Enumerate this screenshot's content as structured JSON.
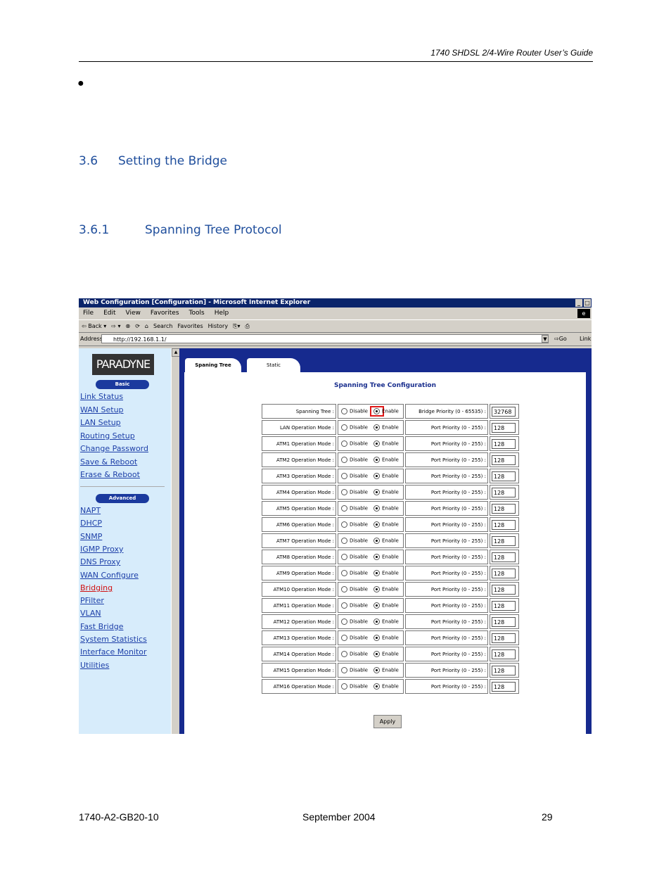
{
  "header": {
    "title": "1740 SHDSL 2/4-Wire Router User’s Guide"
  },
  "bullet": "●",
  "section": {
    "number": "3.6",
    "title": "Setting the Bridge"
  },
  "subsection": {
    "number": "3.6.1",
    "title": "Spanning Tree Protocol"
  },
  "screenshot": {
    "window_title": "Web Configuration [Configuration] - Microsoft Internet Explorer",
    "window_buttons": [
      "_",
      "□"
    ],
    "menu": [
      "File",
      "Edit",
      "View",
      "Favorites",
      "Tools",
      "Help"
    ],
    "toolbar": [
      "⇦ Back ▾",
      "⇨ ▾",
      "⊗",
      "⟳",
      "⌂",
      "Search",
      "Favorites",
      "History",
      "⎘▾",
      "⎙"
    ],
    "address_label": "Address",
    "address_value": "http://192.168.1.1/",
    "go_label": "⇨Go",
    "links_label": "Link",
    "logo": "PARADYNE",
    "basic_label": "Basic",
    "advanced_label": "Advanced",
    "nav_basic": [
      "Link Status",
      "WAN Setup",
      "LAN Setup",
      "Routing Setup",
      "Change Password",
      "Save & Reboot",
      "Erase & Reboot"
    ],
    "nav_advanced": [
      "NAPT",
      "DHCP",
      "SNMP",
      "IGMP Proxy",
      "DNS Proxy",
      "WAN Configure",
      "Bridging",
      "PFilter",
      "VLAN",
      "Fast Bridge",
      "System Statistics",
      "Interface Monitor",
      "Utilities"
    ],
    "tabs": [
      "Spaning Tree",
      "Static"
    ],
    "config_title": "Spanning Tree Configuration",
    "disable_label": "Disable",
    "enable_label": "Enable",
    "rows": [
      {
        "label": "Spanning Tree :",
        "priority_label": "Bridge Priority (0 - 65535) :",
        "value": "32768"
      },
      {
        "label": "LAN Operation Mode :",
        "priority_label": "Port Priority (0 - 255) :",
        "value": "128"
      },
      {
        "label": "ATM1 Operation Mode :",
        "priority_label": "Port Priority (0 - 255) :",
        "value": "128"
      },
      {
        "label": "ATM2 Operation Mode :",
        "priority_label": "Port Priority (0 - 255) :",
        "value": "128"
      },
      {
        "label": "ATM3 Operation Mode :",
        "priority_label": "Port Priority (0 - 255) :",
        "value": "128"
      },
      {
        "label": "ATM4 Operation Mode :",
        "priority_label": "Port Priority (0 - 255) :",
        "value": "128"
      },
      {
        "label": "ATM5 Operation Mode :",
        "priority_label": "Port Priority (0 - 255) :",
        "value": "128"
      },
      {
        "label": "ATM6 Operation Mode :",
        "priority_label": "Port Priority (0 - 255) :",
        "value": "128"
      },
      {
        "label": "ATM7 Operation Mode :",
        "priority_label": "Port Priority (0 - 255) :",
        "value": "128"
      },
      {
        "label": "ATM8 Operation Mode :",
        "priority_label": "Port Priority (0 - 255) :",
        "value": "128"
      },
      {
        "label": "ATM9 Operation Mode :",
        "priority_label": "Port Priority (0 - 255) :",
        "value": "128"
      },
      {
        "label": "ATM10 Operation Mode :",
        "priority_label": "Port Priority (0 - 255) :",
        "value": "128"
      },
      {
        "label": "ATM11 Operation Mode :",
        "priority_label": "Port Priority (0 - 255) :",
        "value": "128"
      },
      {
        "label": "ATM12 Operation Mode :",
        "priority_label": "Port Priority (0 - 255) :",
        "value": "128"
      },
      {
        "label": "ATM13 Operation Mode :",
        "priority_label": "Port Priority (0 - 255) :",
        "value": "128"
      },
      {
        "label": "ATM14 Operation Mode :",
        "priority_label": "Port Priority (0 - 255) :",
        "value": "128"
      },
      {
        "label": "ATM15 Operation Mode :",
        "priority_label": "Port Priority (0 - 255) :",
        "value": "128"
      },
      {
        "label": "ATM16 Operation Mode :",
        "priority_label": "Port Priority (0 - 255) :",
        "value": "128"
      }
    ],
    "apply_label": "Apply"
  },
  "footer": {
    "doc_id": "1740-A2-GB20-10",
    "date": "September 2004",
    "page": "29"
  }
}
